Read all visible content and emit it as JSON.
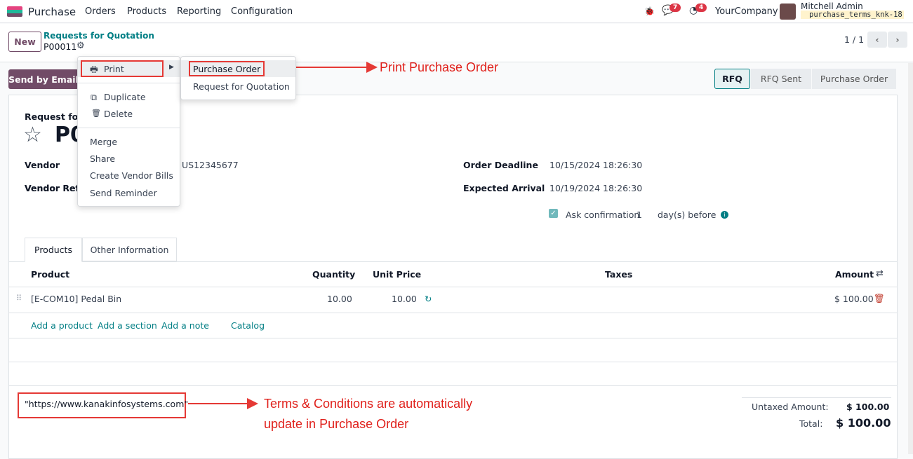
{
  "nav": {
    "app": "Purchase",
    "menus": [
      "Orders",
      "Products",
      "Reporting",
      "Configuration"
    ],
    "messages_count": "7",
    "activities_count": "4",
    "company": "YourCompany",
    "user": "Mitchell Admin",
    "database": "purchase_terms_knk-18"
  },
  "control": {
    "new_label": "New",
    "breadcrumb": "Requests for Quotation",
    "record": "P00011",
    "pager": "1 / 1"
  },
  "actions": {
    "send_email": "Send by Email"
  },
  "status": {
    "stages": [
      "RFQ",
      "RFQ Sent",
      "Purchase Order"
    ],
    "active": "RFQ"
  },
  "menu": {
    "print": "Print",
    "duplicate": "Duplicate",
    "delete": "Delete",
    "others": [
      "Merge",
      "Share",
      "Create Vendor Bills",
      "Send Reminder"
    ]
  },
  "submenu": [
    "Purchase Order",
    "Request for Quotation"
  ],
  "annotations": {
    "print_po": "Print Purchase Order",
    "terms_line1": "Terms & Conditions are automatically",
    "terms_line2": "update in Purchase Order",
    "color": "#e53935"
  },
  "form": {
    "title_label": "Request for Quotation",
    "title_visible": "Request for (",
    "name_visible": "P0",
    "vendor_label": "Vendor",
    "vendor_value": "US12345677",
    "vendor_ref_label": "Vendor Reference",
    "vendor_ref_visible": "Vendor Refe",
    "deadline_label": "Order Deadline",
    "deadline_value": "10/15/2024 18:26:30",
    "arrival_label": "Expected Arrival",
    "arrival_value": "10/19/2024 18:26:30",
    "ask_confirm_label": "Ask confirmation",
    "ask_confirm_days": "1",
    "ask_confirm_suffix": "day(s) before",
    "ask_confirm_checked": true
  },
  "tabs": [
    "Products",
    "Other Information"
  ],
  "table": {
    "headers": [
      "Product",
      "Quantity",
      "Unit Price",
      "Taxes",
      "Amount"
    ],
    "rows": [
      {
        "product": "[E-COM10] Pedal Bin",
        "quantity": "10.00",
        "unit_price": "10.00",
        "amount": "$ 100.00"
      }
    ],
    "add_links": [
      "Add a product",
      "Add a section",
      "Add a note",
      "Catalog"
    ]
  },
  "terms": "\"https://www.kanakinfosystems.com\"",
  "totals": {
    "untaxed_label": "Untaxed Amount:",
    "untaxed": "$ 100.00",
    "total_label": "Total:",
    "total": "$ 100.00"
  },
  "brand_color": "#714B67"
}
